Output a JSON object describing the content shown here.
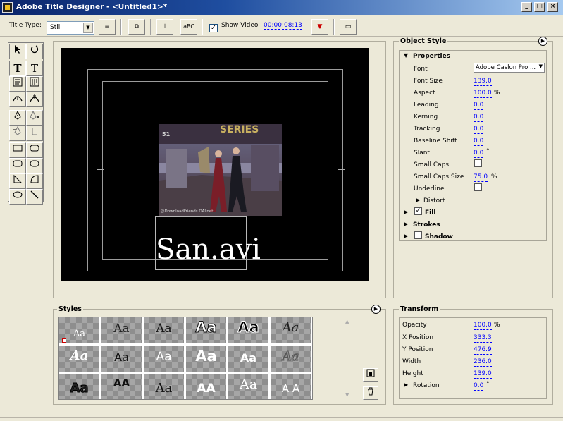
{
  "window": {
    "title": "Adobe Title Designer - <Untitled1>*",
    "minimize": "_",
    "maximize": "□",
    "close": "×"
  },
  "toolbar": {
    "title_type_label": "Title Type:",
    "title_type_value": "Still",
    "show_video_checked": "✓",
    "show_video_label": "Show Video",
    "timecode": "00:00:08:13",
    "btn_tab": "≡",
    "btn_template": "⧉",
    "btn_align": "⊥",
    "btn_kern": "aBC",
    "btn_marker": "▼",
    "btn_bg": "▭"
  },
  "tools": [
    "select",
    "rotate",
    "type",
    "vertical-type",
    "area-type",
    "vertical-area-type",
    "path-type",
    "vertical-path-type",
    "pen",
    "add-anchor",
    "delete-anchor",
    "convert-anchor",
    "rectangle",
    "clipped-rectangle",
    "rounded-rectangle",
    "rounded-corner-rectangle",
    "wedge",
    "arc",
    "ellipse",
    "line"
  ],
  "canvas": {
    "text": "San.avi",
    "video_overlay": "SERIES",
    "video_badge": "51",
    "video_caption": "@DownloadFriends OALnet"
  },
  "object_style": {
    "title": "Object Style",
    "properties_label": "Properties",
    "rows": [
      {
        "label": "Font",
        "value": "Adobe Caslon Pro ..."
      },
      {
        "label": "Font Size",
        "value": "139.0",
        "unit": ""
      },
      {
        "label": "Aspect",
        "value": "100.0",
        "unit": "%"
      },
      {
        "label": "Leading",
        "value": "0.0",
        "unit": ""
      },
      {
        "label": "Kerning",
        "value": "0.0",
        "unit": ""
      },
      {
        "label": "Tracking",
        "value": "0.0",
        "unit": ""
      },
      {
        "label": "Baseline Shift",
        "value": "0.0",
        "unit": ""
      },
      {
        "label": "Slant",
        "value": "0.0",
        "unit": "°"
      },
      {
        "label": "Small Caps",
        "value": "",
        "unit": ""
      },
      {
        "label": "Small Caps Size",
        "value": "75.0",
        "unit": "%"
      },
      {
        "label": "Underline",
        "value": "",
        "unit": ""
      }
    ],
    "distort": "Distort",
    "fill": "Fill",
    "fill_checked": "✓",
    "strokes": "Strokes",
    "shadow": "Shadow"
  },
  "styles": {
    "title": "Styles",
    "swatches": [
      "Aa",
      "Aa",
      "Aa",
      "Aa",
      "Aa",
      "Aa",
      "Aa",
      "Aa",
      "Aa",
      "Aa",
      "Aa",
      "Aa",
      "Aa",
      "AA",
      "Aa",
      "AA",
      "Aa",
      "A A"
    ]
  },
  "transform": {
    "title": "Transform",
    "rows": [
      {
        "label": "Opacity",
        "value": "100.0",
        "unit": "%"
      },
      {
        "label": "X Position",
        "value": "333.3",
        "unit": ""
      },
      {
        "label": "Y Position",
        "value": "476.9",
        "unit": ""
      },
      {
        "label": "Width",
        "value": "236.0",
        "unit": ""
      },
      {
        "label": "Height",
        "value": "139.0",
        "unit": ""
      },
      {
        "label": "Rotation",
        "value": "0.0",
        "unit": "°"
      }
    ]
  },
  "colors": {
    "title_bar": "#0a246a",
    "panel_bg": "#ece9d8",
    "value_blue": "#0000ff",
    "canvas_bg": "#000000"
  }
}
